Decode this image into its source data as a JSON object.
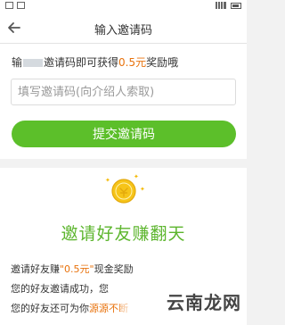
{
  "header": {
    "title": "输入邀请码"
  },
  "invite": {
    "hint_prefix": "输",
    "hint_main": "邀请码即可获得",
    "hint_amount": "0.5元",
    "hint_suffix": "奖励哦",
    "placeholder": "填写邀请码(向介绍人索取)",
    "submit_label": "提交邀请码"
  },
  "promo": {
    "title": "邀请好友赚翻天",
    "line1_a": "邀请好友赚",
    "line1_hl": "\"0.5元\"",
    "line1_b": "现金奖励",
    "line2": "您的好友邀请成功，您",
    "line3_a": "您的好友还可为你",
    "line3_hl": "源源不断"
  },
  "watermark": "云南龙网",
  "colors": {
    "accent_green": "#5cbf2a",
    "highlight_orange": "#e8720c"
  }
}
